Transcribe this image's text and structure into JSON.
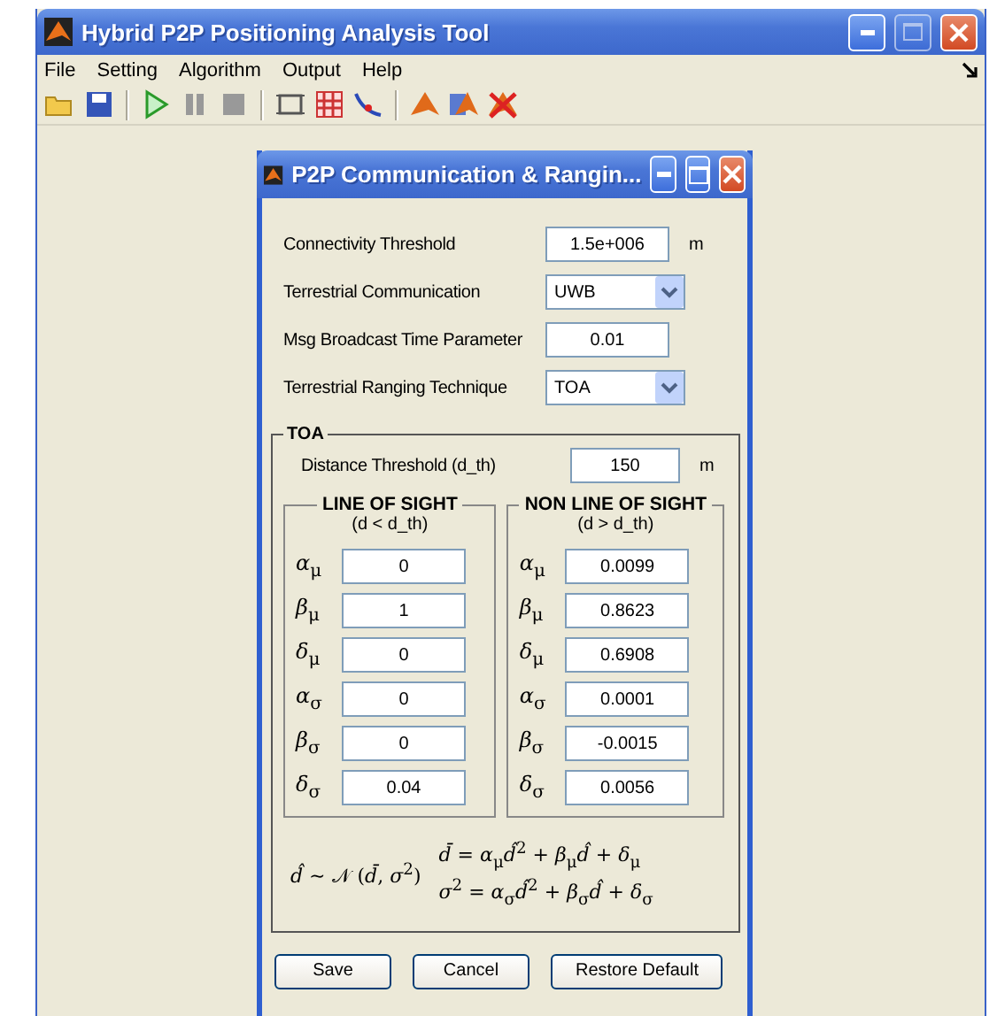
{
  "main_window": {
    "title": "Hybrid P2P Positioning Analysis Tool",
    "menu": [
      "File",
      "Setting",
      "Algorithm",
      "Output",
      "Help"
    ],
    "toolbar": [
      {
        "kind": "open"
      },
      {
        "kind": "save"
      },
      {
        "kind": "separator"
      },
      {
        "kind": "play"
      },
      {
        "kind": "pause"
      },
      {
        "kind": "stop"
      },
      {
        "kind": "separator"
      },
      {
        "kind": "frame"
      },
      {
        "kind": "grid"
      },
      {
        "kind": "curve"
      },
      {
        "kind": "separator"
      },
      {
        "kind": "peak"
      },
      {
        "kind": "peak-window"
      },
      {
        "kind": "peak-cross"
      }
    ]
  },
  "dialog": {
    "title": "P2P Communication & Rangin...",
    "settings": [
      {
        "kind": "field",
        "label": "Connectivity Threshold",
        "value": "1.5e+006",
        "unit": "m"
      },
      {
        "kind": "dropdown",
        "label": "Terrestrial Communication",
        "value": "UWB"
      },
      {
        "kind": "field",
        "label": "Msg Broadcast Time Parameter",
        "value": "0.01"
      },
      {
        "kind": "dropdown",
        "label": "Terrestrial Ranging Technique",
        "value": "TOA"
      }
    ],
    "toa": {
      "title": "TOA",
      "distance": {
        "label": "Distance Threshold (d_th)",
        "value": "150",
        "unit": "m"
      },
      "groups": [
        {
          "title": "LINE OF SIGHT",
          "condition": "(d < d_th)",
          "params": [
            {
              "symbol": "*α*$_{μ}$",
              "value": "0"
            },
            {
              "symbol": "*β*$_{μ}$",
              "value": "1"
            },
            {
              "symbol": "*δ*$_{μ}$",
              "value": "0"
            },
            {
              "symbol": "*α*$_{σ}$",
              "value": "0"
            },
            {
              "symbol": "*β*$_{σ}$",
              "value": "0"
            },
            {
              "symbol": "*δ*$_{σ}$",
              "value": "0.04"
            }
          ]
        },
        {
          "title": "NON LINE OF SIGHT",
          "condition": "(d > d_th)",
          "params": [
            {
              "symbol": "*α*$_{μ}$",
              "value": "0.0099"
            },
            {
              "symbol": "*β*$_{μ}$",
              "value": "0.8623"
            },
            {
              "symbol": "*δ*$_{μ}$",
              "value": "0.6908"
            },
            {
              "symbol": "*α*$_{σ}$",
              "value": "0.0001"
            },
            {
              "symbol": "*β*$_{σ}$",
              "value": "-0.0015"
            },
            {
              "symbol": "*δ*$_{σ}$",
              "value": "0.0056"
            }
          ]
        }
      ],
      "formula": {
        "left": "*d̂* ∼ 𝒩 (*d̄*, *σ*$^{2}$)",
        "lines": [
          "*d̄* = *α*$_{μ}$*d̂*$^{2}$ + *β*$_{μ}$*d̂* + *δ*$_{μ}$",
          "*σ*$^{2}$ = *α*$_{σ}$*d̂*$^{2}$ + *β*$_{σ}$*d̂* + *δ*$_{σ}$"
        ]
      }
    },
    "buttons": [
      "Save",
      "Cancel",
      "Restore Default"
    ]
  }
}
